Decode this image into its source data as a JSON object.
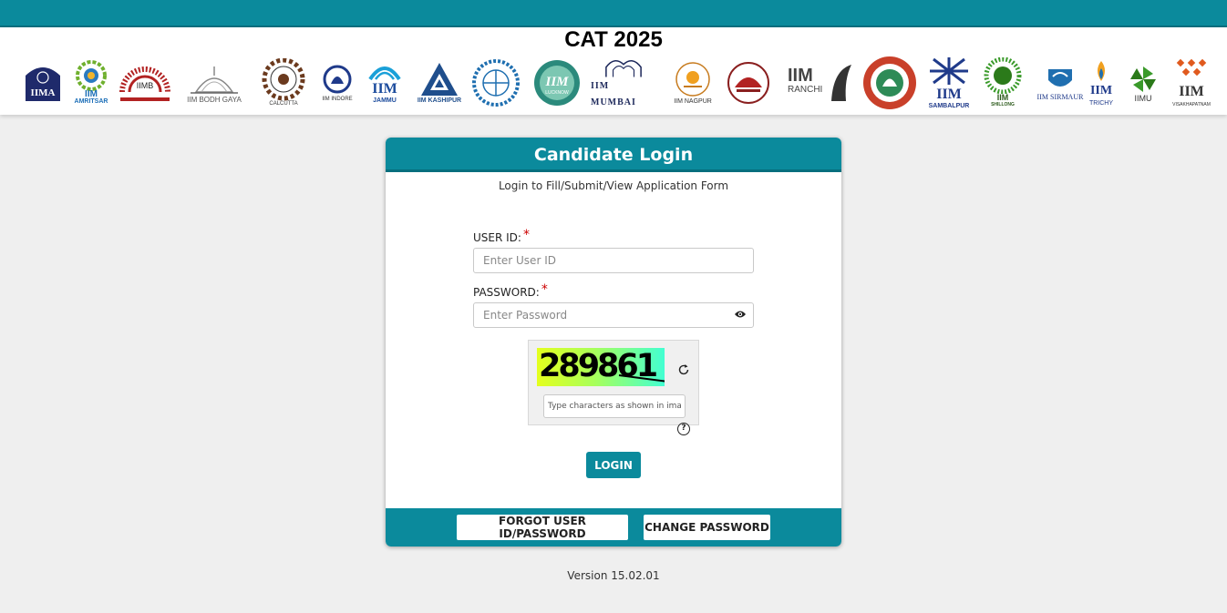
{
  "header": {
    "title": "CAT 2025",
    "logos": [
      {
        "name": "IIMA",
        "caption": ""
      },
      {
        "name": "IIM",
        "caption": "AMRITSAR"
      },
      {
        "name": "IIMB",
        "caption": ""
      },
      {
        "name": "IIM BODH GAYA",
        "caption": ""
      },
      {
        "name": "CALCUTTA",
        "caption": ""
      },
      {
        "name": "IIM INDORE",
        "caption": ""
      },
      {
        "name": "IIM",
        "caption": "JAMMU"
      },
      {
        "name": "IIM KASHIPUR",
        "caption": ""
      },
      {
        "name": "IIM KOZHIKODE",
        "caption": ""
      },
      {
        "name": "IIM",
        "caption": "LUCKNOW"
      },
      {
        "name": "IIM MUMBAI",
        "caption": ""
      },
      {
        "name": "IIM NAGPUR",
        "caption": ""
      },
      {
        "name": "IIM RAIPUR",
        "caption": ""
      },
      {
        "name": "IIM",
        "caption": "RANCHI"
      },
      {
        "name": "IIM ROHTAK",
        "caption": ""
      },
      {
        "name": "IIM",
        "caption": "SAMBALPUR"
      },
      {
        "name": "IIM",
        "caption": "SHILLONG"
      },
      {
        "name": "IIM SIRMAUR",
        "caption": ""
      },
      {
        "name": "IIM",
        "caption": "TRICHY"
      },
      {
        "name": "IIMU",
        "caption": ""
      },
      {
        "name": "IIM",
        "caption": "VISAKHAPATNAM"
      }
    ]
  },
  "login": {
    "title": "Candidate Login",
    "subtitle": "Login to Fill/Submit/View Application Form",
    "userid_label": "USER ID:",
    "userid_placeholder": "Enter User ID",
    "password_label": "PASSWORD:",
    "password_placeholder": "Enter Password",
    "required_mark": "*",
    "captcha_text": "289861",
    "captcha_placeholder": "Type characters as shown in image",
    "help_symbol": "?",
    "login_button": "LOGIN"
  },
  "footer": {
    "forgot_button": "FORGOT USER ID/PASSWORD",
    "change_password_button": "CHANGE PASSWORD",
    "version": "Version 15.02.01"
  },
  "colors": {
    "primary": "#0b8a9c",
    "primary_dark": "#066f7e",
    "required": "#cc0000",
    "background": "#efefef"
  },
  "icons": {
    "password_toggle": "eye-icon",
    "captcha_refresh": "refresh-icon",
    "captcha_help": "help-icon"
  }
}
